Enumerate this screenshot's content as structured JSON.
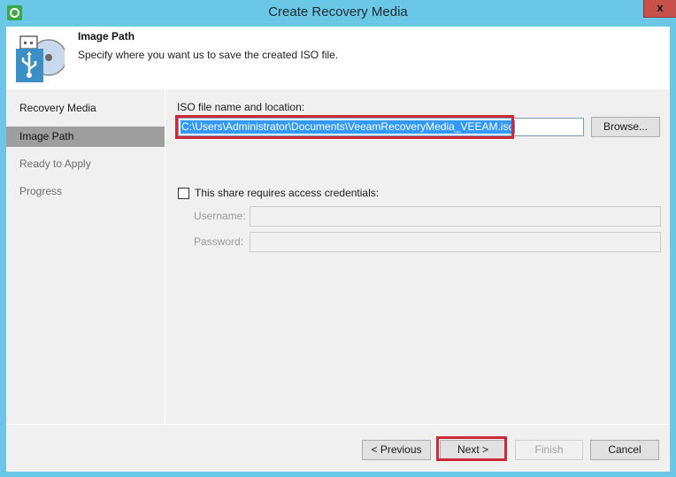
{
  "window": {
    "title": "Create Recovery Media",
    "app_icon": "veeam-lifebuoy-icon",
    "close_label": "x"
  },
  "header": {
    "icon": "usb-disc-icon",
    "title": "Image Path",
    "subtitle": "Specify where you want us to save the created ISO file."
  },
  "sidebar": {
    "steps": [
      {
        "label": "Recovery Media",
        "state": "done"
      },
      {
        "label": "Image Path",
        "state": "active"
      },
      {
        "label": "Ready to Apply",
        "state": "pending"
      },
      {
        "label": "Progress",
        "state": "pending"
      }
    ]
  },
  "form": {
    "iso_label": "ISO file name and location:",
    "iso_value": "C:\\Users\\Administrator\\Documents\\VeeamRecoveryMedia_VEEAM.iso",
    "browse_label": "Browse...",
    "credentials_checkbox_label": "This share requires access credentials:",
    "credentials_checked": false,
    "username_label": "Username:",
    "username_value": "",
    "password_label": "Password:",
    "password_value": ""
  },
  "footer": {
    "previous_label": "< Previous",
    "next_label": "Next >",
    "finish_label": "Finish",
    "cancel_label": "Cancel"
  },
  "annotations": {
    "highlight_color": "#cc2a36"
  }
}
